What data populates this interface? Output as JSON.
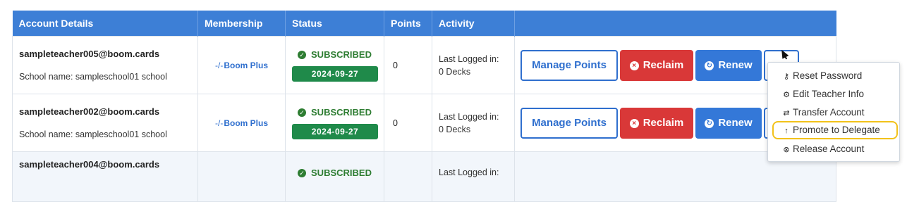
{
  "table": {
    "headers": [
      "Account Details",
      "Membership",
      "Status",
      "Points",
      "Activity",
      ""
    ],
    "rows": [
      {
        "email": "sampleteacher005@boom.cards",
        "school": "School name: sampleschool01 school",
        "membership": "Boom Plus",
        "status": "SUBSCRIBED",
        "date": "2024-09-27",
        "points": "0",
        "activity_line1": "Last Logged in:",
        "activity_line2": "0 Decks"
      },
      {
        "email": "sampleteacher002@boom.cards",
        "school": "School name: sampleschool01 school",
        "membership": "Boom Plus",
        "status": "SUBSCRIBED",
        "date": "2024-09-27",
        "points": "0",
        "activity_line1": "Last Logged in:",
        "activity_line2": "0 Decks"
      },
      {
        "email": "sampleteacher004@boom.cards",
        "status": "SUBSCRIBED",
        "activity_line1": "Last Logged in:"
      }
    ]
  },
  "actions": {
    "manage_points": "Manage Points",
    "reclaim": "Reclaim",
    "renew": "Renew"
  },
  "dropdown": {
    "items": [
      {
        "label": "Reset Password",
        "icon": "key-icon"
      },
      {
        "label": "Edit Teacher Info",
        "icon": "gear-icon"
      },
      {
        "label": "Transfer Account",
        "icon": "transfer-icon"
      },
      {
        "label": "Promote to Delegate",
        "icon": "arrow-up-icon",
        "highlighted": true
      },
      {
        "label": "Release Account",
        "icon": "close-circle-icon"
      }
    ]
  },
  "colors": {
    "header_bg": "#3d7fd6",
    "subscribed_green": "#2e7d32",
    "date_badge": "#1f8a4a",
    "reclaim_red": "#d93838",
    "renew_blue": "#3478d8",
    "highlight": "#f2c21b"
  }
}
